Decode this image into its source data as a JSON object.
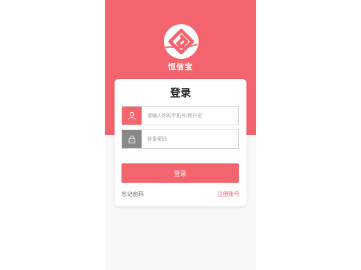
{
  "brand": {
    "name": "恒信宝",
    "accent_color": "#f4646e"
  },
  "login_card": {
    "title": "登录",
    "username": {
      "icon": "user-icon",
      "placeholder": "请输入你的手机号/用户名",
      "value": ""
    },
    "password": {
      "icon": "lock-icon",
      "placeholder": "登录密码",
      "value": ""
    },
    "submit_label": "登录",
    "forgot_password_label": "忘记密码",
    "register_label": "注册账号"
  }
}
